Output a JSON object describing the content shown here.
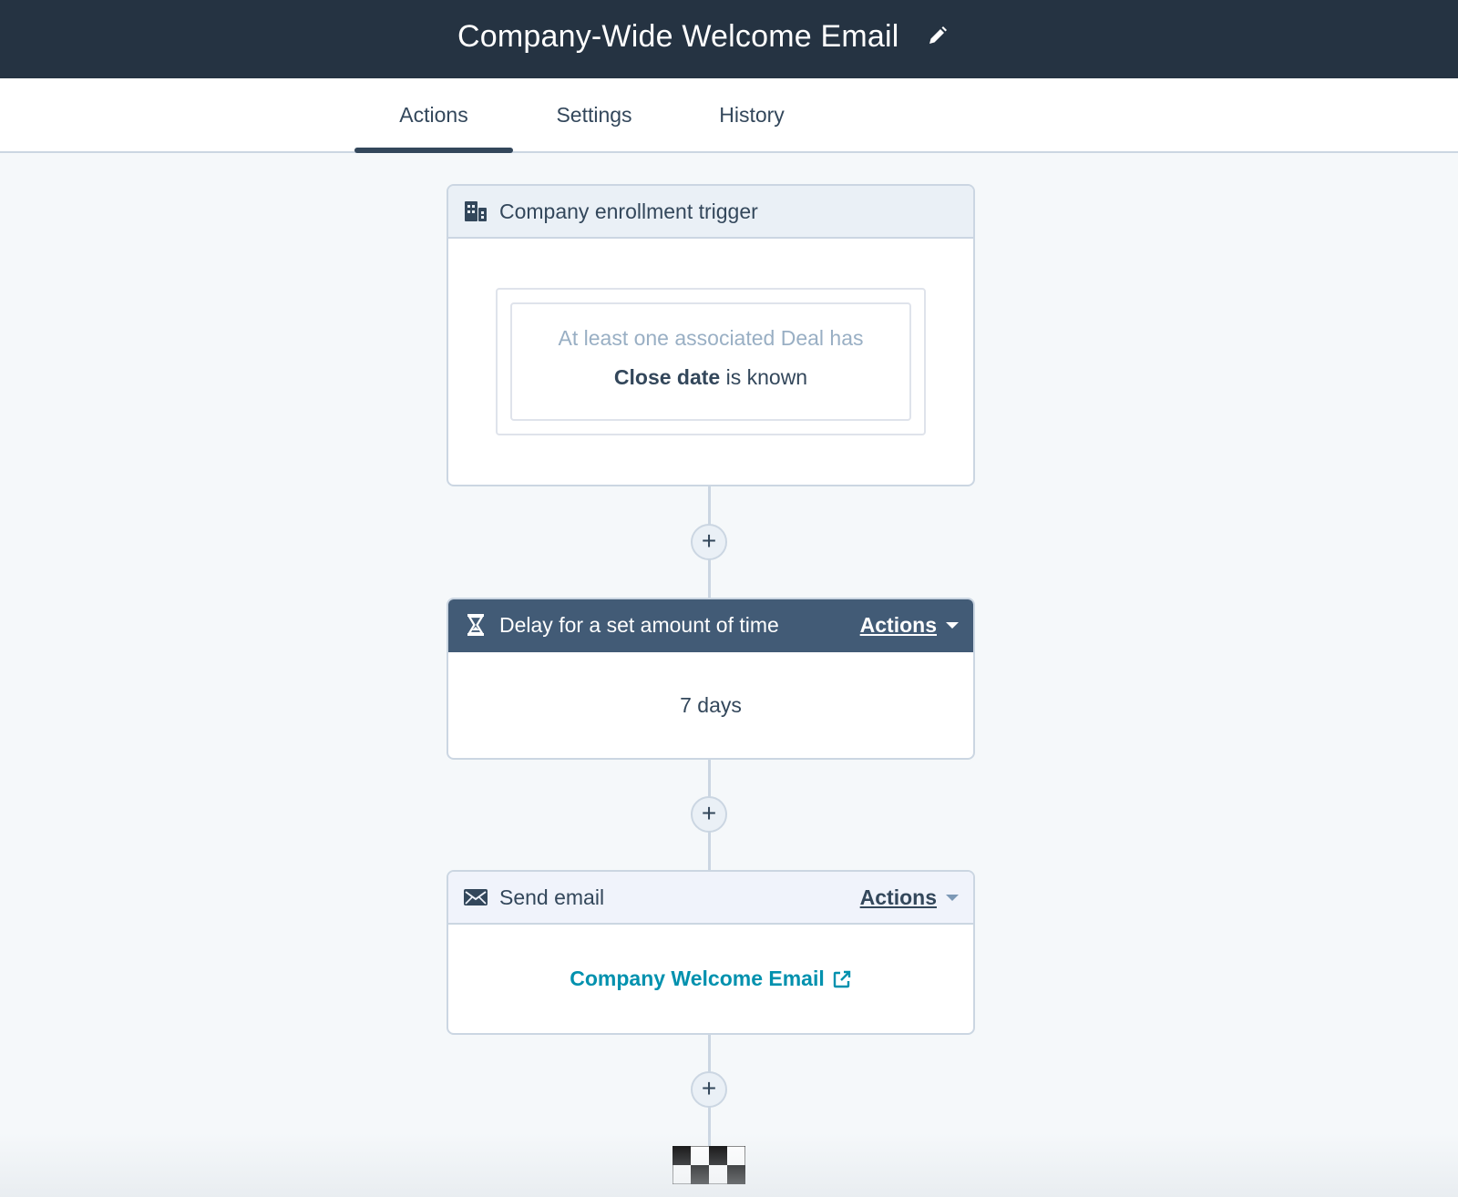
{
  "header": {
    "title": "Company-Wide Welcome Email",
    "edit_icon": "pencil-icon"
  },
  "tabs": [
    {
      "label": "Actions",
      "active": true
    },
    {
      "label": "Settings",
      "active": false
    },
    {
      "label": "History",
      "active": false
    }
  ],
  "trigger": {
    "icon": "building-icon",
    "title": "Company enrollment trigger",
    "condition_prefix": "At least one associated Deal has",
    "condition_property": "Close date",
    "condition_operator": "is known"
  },
  "delay": {
    "icon": "hourglass-icon",
    "title": "Delay for a set amount of time",
    "actions_label": "Actions",
    "value": "7 days"
  },
  "send_email": {
    "icon": "envelope-icon",
    "title": "Send email",
    "actions_label": "Actions",
    "email_name": "Company Welcome Email",
    "link_icon": "external-link-icon"
  },
  "plus_symbol": "+",
  "colors": {
    "topbar": "#253342",
    "delay_header": "#425b76",
    "link": "#0091ae",
    "text": "#33475b",
    "muted": "#99afc4"
  }
}
